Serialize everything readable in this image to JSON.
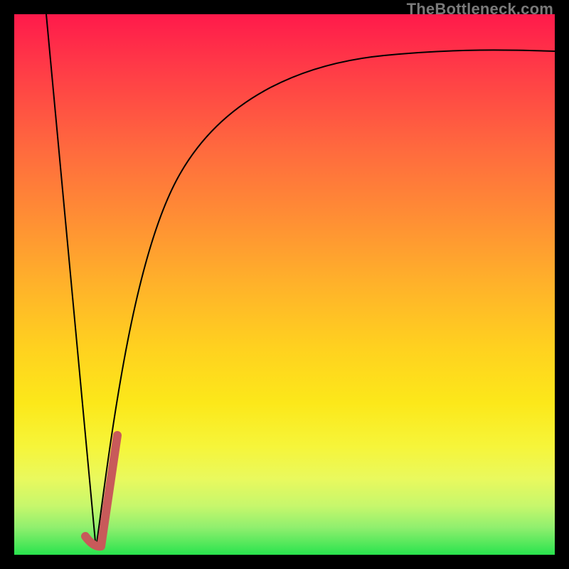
{
  "watermark": {
    "text": "TheBottleneck.com"
  },
  "chart_data": {
    "type": "line",
    "title": "",
    "xlabel": "",
    "ylabel": "",
    "xlim": [
      0,
      100
    ],
    "ylim": [
      0,
      100
    ],
    "grid": false,
    "background_gradient": {
      "direction": "vertical",
      "stops": [
        {
          "pos": 0.0,
          "color": "#ff1a4b"
        },
        {
          "pos": 0.5,
          "color": "#ffb22a"
        },
        {
          "pos": 0.8,
          "color": "#f6f53a"
        },
        {
          "pos": 1.0,
          "color": "#29e34e"
        }
      ]
    },
    "series": [
      {
        "name": "left-falling-line",
        "stroke": "#000000",
        "stroke_width": 2,
        "x": [
          6,
          15
        ],
        "y": [
          100,
          1
        ]
      },
      {
        "name": "right-rising-curve",
        "stroke": "#000000",
        "stroke_width": 2,
        "x": [
          15,
          18,
          22,
          27,
          33,
          40,
          50,
          60,
          72,
          86,
          100
        ],
        "y": [
          1,
          24,
          44,
          60,
          71,
          78,
          84,
          87.5,
          90,
          92,
          93
        ]
      },
      {
        "name": "marker-hook",
        "stroke": "#c85a5a",
        "stroke_width": 10,
        "linecap": "round",
        "x": [
          13.2,
          15.5,
          18.8
        ],
        "y": [
          3.5,
          1.8,
          22
        ]
      }
    ]
  }
}
